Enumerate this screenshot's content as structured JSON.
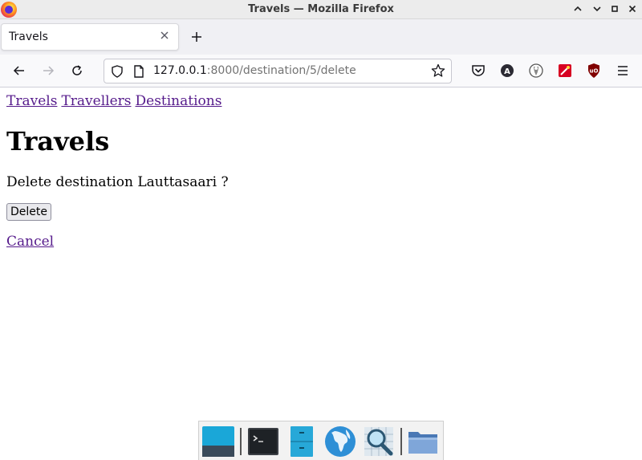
{
  "window": {
    "title": "Travels — Mozilla Firefox",
    "controls": {
      "minimize": "⌃",
      "restore": "⌄",
      "maximize": "▫",
      "close": "✕"
    }
  },
  "tabs": [
    {
      "title": "Travels",
      "active": true
    }
  ],
  "toolbar": {
    "url_host": "127.0.0.1",
    "url_path": ":8000/destination/5/delete",
    "icons": [
      "back-icon",
      "forward-icon",
      "reload-icon",
      "shield-icon",
      "page-icon",
      "bookmark-star-icon",
      "pocket-icon",
      "account-icon",
      "privacy-badger-icon",
      "extension-icon",
      "ublock-icon",
      "menu-icon"
    ]
  },
  "page": {
    "nav_links": [
      "Travels",
      "Travellers",
      "Destinations"
    ],
    "heading": "Travels",
    "confirm_text": "Delete destination Lauttasaari ?",
    "delete_label": "Delete",
    "cancel_label": "Cancel"
  },
  "dock": {
    "items": [
      "desktop-icon",
      "terminal-icon",
      "file-cabinet-icon",
      "web-browser-icon",
      "search-icon",
      "folder-icon"
    ]
  },
  "colors": {
    "link_visited": "#551a8b",
    "tab_strip": "#f0f0f4",
    "nav_bar": "#f9f9fb"
  }
}
